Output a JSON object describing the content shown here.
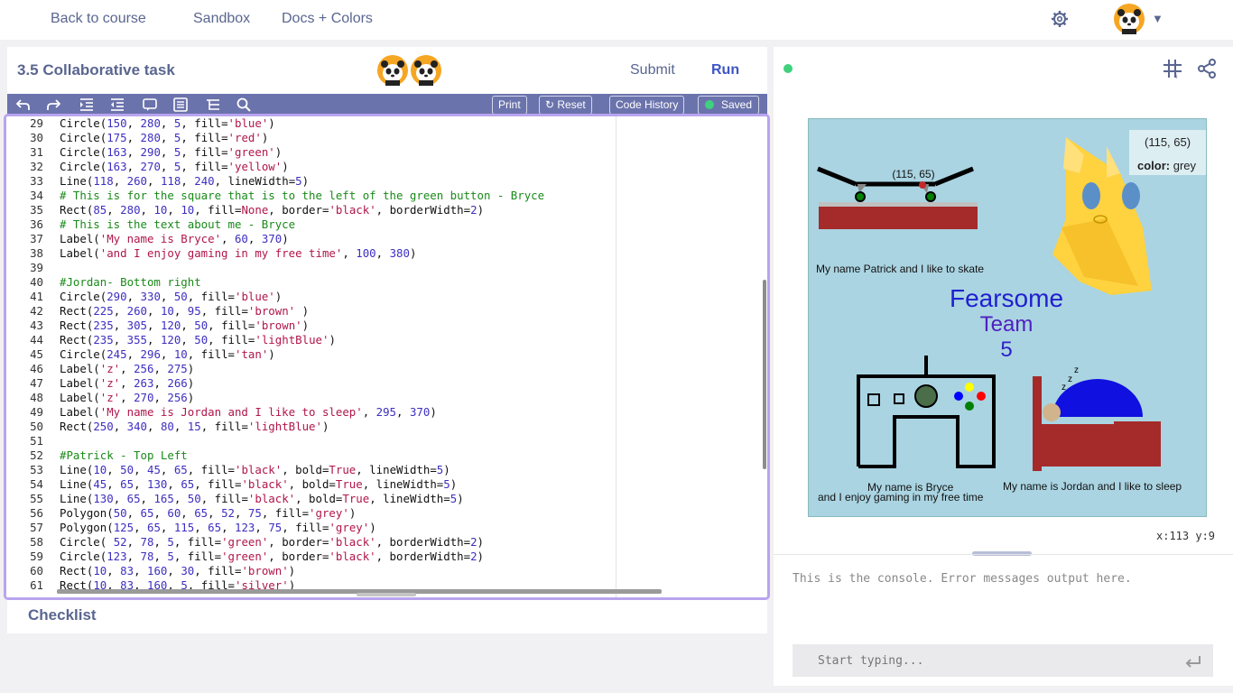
{
  "nav": {
    "back": "Back to course",
    "sandbox": "Sandbox",
    "docs": "Docs + Colors"
  },
  "task": {
    "title": "3.5 Collaborative task",
    "submit": "Submit",
    "run": "Run"
  },
  "toolbar": {
    "print": "Print",
    "reset": "Reset",
    "history": "Code History",
    "saved": "Saved"
  },
  "code": [
    {
      "n": "29",
      "t": "Circle(150, 280, 5, fill='blue')"
    },
    {
      "n": "30",
      "t": "Circle(175, 280, 5, fill='red')"
    },
    {
      "n": "31",
      "t": "Circle(163, 290, 5, fill='green')"
    },
    {
      "n": "32",
      "t": "Circle(163, 270, 5, fill='yellow')"
    },
    {
      "n": "33",
      "t": "Line(118, 260, 118, 240, lineWidth=5)"
    },
    {
      "n": "34",
      "t": "# This is for the square that is to the left of the green button - Bryce"
    },
    {
      "n": "35",
      "t": "Rect(85, 280, 10, 10, fill=None, border='black', borderWidth=2)"
    },
    {
      "n": "36",
      "t": "# This is the text about me - Bryce"
    },
    {
      "n": "37",
      "t": "Label('My name is Bryce', 60, 370)"
    },
    {
      "n": "38",
      "t": "Label('and I enjoy gaming in my free time', 100, 380)"
    },
    {
      "n": "39",
      "t": ""
    },
    {
      "n": "40",
      "t": "#Jordan- Bottom right"
    },
    {
      "n": "41",
      "t": "Circle(290, 330, 50, fill='blue')"
    },
    {
      "n": "42",
      "t": "Rect(225, 260, 10, 95, fill='brown' )"
    },
    {
      "n": "43",
      "t": "Rect(235, 305, 120, 50, fill='brown')"
    },
    {
      "n": "44",
      "t": "Rect(235, 355, 120, 50, fill='lightBlue')"
    },
    {
      "n": "45",
      "t": "Circle(245, 296, 10, fill='tan')"
    },
    {
      "n": "46",
      "t": "Label('z', 256, 275)"
    },
    {
      "n": "47",
      "t": "Label('z', 263, 266)"
    },
    {
      "n": "48",
      "t": "Label('z', 270, 256)"
    },
    {
      "n": "49",
      "t": "Label('My name is Jordan and I like to sleep', 295, 370)"
    },
    {
      "n": "50",
      "t": "Rect(250, 340, 80, 15, fill='lightBlue')"
    },
    {
      "n": "51",
      "t": ""
    },
    {
      "n": "52",
      "t": "#Patrick - Top Left"
    },
    {
      "n": "53",
      "t": "Line(10, 50, 45, 65, fill='black', bold=True, lineWidth=5)"
    },
    {
      "n": "54",
      "t": "Line(45, 65, 130, 65, fill='black', bold=True, lineWidth=5)"
    },
    {
      "n": "55",
      "t": "Line(130, 65, 165, 50, fill='black', bold=True, lineWidth=5)"
    },
    {
      "n": "56",
      "t": "Polygon(50, 65, 60, 65, 52, 75, fill='grey')"
    },
    {
      "n": "57",
      "t": "Polygon(125, 65, 115, 65, 123, 75, fill='grey')"
    },
    {
      "n": "58",
      "t": "Circle( 52, 78, 5, fill='green', border='black', borderWidth=2)"
    },
    {
      "n": "59",
      "t": "Circle(123, 78, 5, fill='green', border='black', borderWidth=2)"
    },
    {
      "n": "60",
      "t": "Rect(10, 83, 160, 30, fill='brown')"
    },
    {
      "n": "61",
      "t": "Rect(10, 83, 160, 5, fill='silver')"
    }
  ],
  "checklist": "Checklist",
  "canvas": {
    "tooltip_coords": "(115, 65)",
    "tooltip_color_label": "color:",
    "tooltip_color_value": "grey",
    "board_coords": "(115, 65)",
    "patrick_label": "My name Patrick and I like to skate",
    "title_line1": "Fearsome",
    "title_line2": "Team",
    "title_line3": "5",
    "bryce_label1": "My name is Bryce",
    "bryce_label2": "and I enjoy gaming in my free time",
    "jordan_label": "My name is Jordan and I like to sleep"
  },
  "coords": "x:113 y:9",
  "console": {
    "message": "This is the console. Error messages output here.",
    "placeholder": "Start typing..."
  },
  "colors": {
    "accent": "#3e55c4",
    "toolbar": "#6b73ac",
    "nav_text": "#5a6690",
    "saved": "#3fd17d"
  }
}
